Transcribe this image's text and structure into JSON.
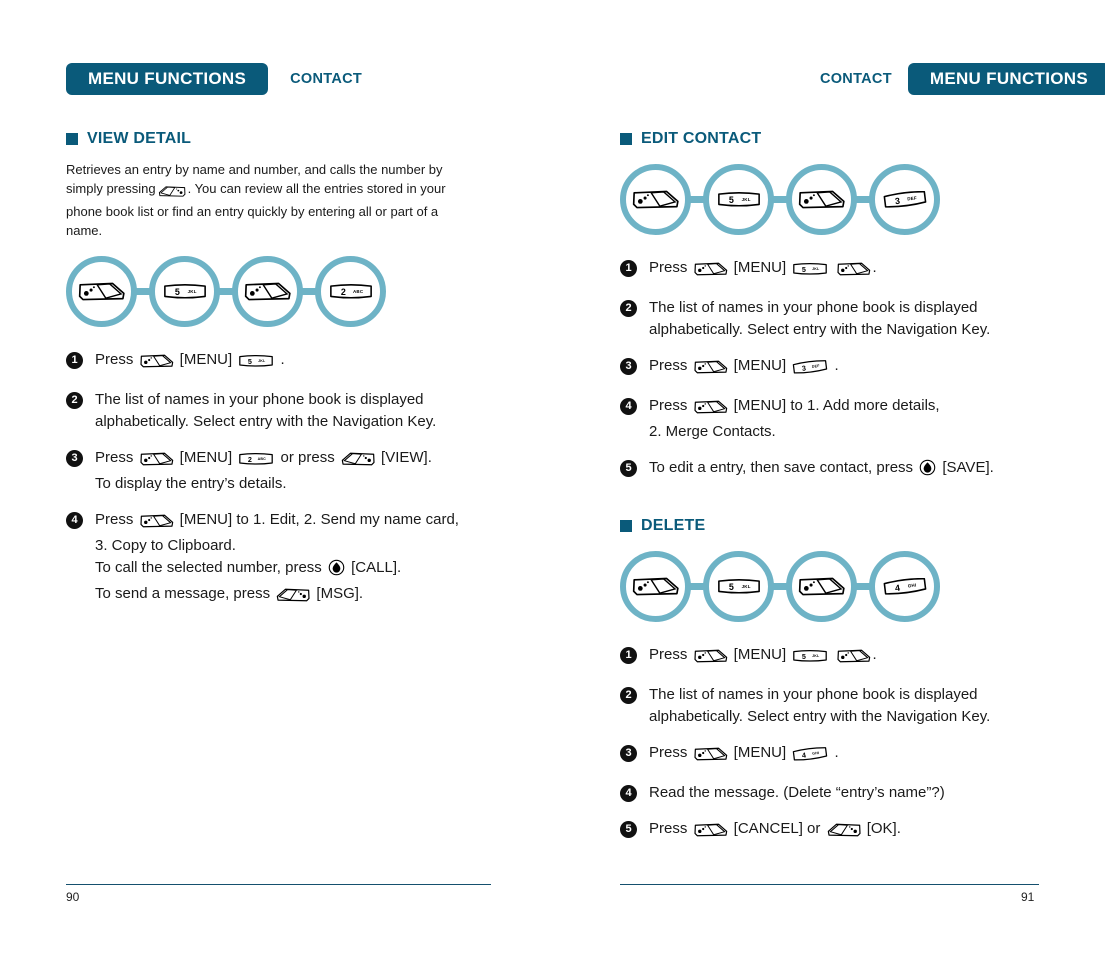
{
  "left_page": {
    "header": {
      "badge": "MENU FUNCTIONS",
      "subtitle": "CONTACT"
    },
    "page_number": "90",
    "sections": [
      {
        "title": "VIEW DETAIL",
        "intro": "Retrieves an entry by name and number, and calls the number by simply pressing  . You can review all the entries stored in your phone book list or find an entry quickly by entering all or part of a name.",
        "intro_line1": "Retrieves an entry by name and number, and calls the number by",
        "intro_line2a": "simply pressing",
        "intro_line2b": ". You can review all the entries stored in your",
        "intro_line3": "phone book list or find an entry quickly by entering all or part of a",
        "intro_line4": "name.",
        "chain": [
          {
            "icon": "menu-key-icon",
            "label": "MENU"
          },
          {
            "icon": "number-key-icon",
            "label": "5 JKL",
            "digit": "5",
            "letters": "JKL"
          },
          {
            "icon": "menu-key-icon",
            "label": "MENU"
          },
          {
            "icon": "number-key-icon",
            "label": "2 ABC",
            "digit": "2",
            "letters": "ABC"
          }
        ],
        "steps": [
          {
            "num": "1",
            "lines": [
              {
                "parts": [
                  {
                    "t": "text",
                    "v": "Press "
                  },
                  {
                    "t": "icon",
                    "v": "menu-key-icon"
                  },
                  {
                    "t": "text",
                    "v": " [MENU] "
                  },
                  {
                    "t": "icon",
                    "v": "key-5-jkl-icon"
                  },
                  {
                    "t": "text",
                    "v": " ."
                  }
                ]
              }
            ]
          },
          {
            "num": "2",
            "lines": [
              {
                "parts": [
                  {
                    "t": "text",
                    "v": "The list of names in your phone book is displayed"
                  }
                ]
              },
              {
                "parts": [
                  {
                    "t": "text",
                    "v": "alphabetically. Select entry with the Navigation Key."
                  }
                ]
              }
            ]
          },
          {
            "num": "3",
            "lines": [
              {
                "parts": [
                  {
                    "t": "text",
                    "v": "Press "
                  },
                  {
                    "t": "icon",
                    "v": "menu-key-icon"
                  },
                  {
                    "t": "text",
                    "v": " [MENU] "
                  },
                  {
                    "t": "icon",
                    "v": "key-2-abc-icon"
                  },
                  {
                    "t": "text",
                    "v": " or press "
                  },
                  {
                    "t": "icon",
                    "v": "send-key-icon"
                  },
                  {
                    "t": "text",
                    "v": " [VIEW]."
                  }
                ]
              },
              {
                "parts": [
                  {
                    "t": "text",
                    "v": "To display the entry’s details."
                  }
                ]
              }
            ]
          },
          {
            "num": "4",
            "lines": [
              {
                "parts": [
                  {
                    "t": "text",
                    "v": "Press "
                  },
                  {
                    "t": "icon",
                    "v": "menu-key-icon"
                  },
                  {
                    "t": "text",
                    "v": " [MENU] to 1. Edit, 2. Send my name card,"
                  }
                ]
              },
              {
                "parts": [
                  {
                    "t": "text",
                    "v": "3. Copy to Clipboard."
                  }
                ]
              },
              {
                "parts": [
                  {
                    "t": "text",
                    "v": "To call the selected number, press "
                  },
                  {
                    "t": "icon",
                    "v": "power-key-icon"
                  },
                  {
                    "t": "text",
                    "v": " [CALL]."
                  }
                ]
              },
              {
                "parts": [
                  {
                    "t": "text",
                    "v": "To send a message, press "
                  },
                  {
                    "t": "icon",
                    "v": "send-key-icon"
                  },
                  {
                    "t": "text",
                    "v": " [MSG]."
                  }
                ]
              }
            ]
          }
        ]
      }
    ]
  },
  "right_page": {
    "header": {
      "badge": "MENU FUNCTIONS",
      "subtitle": "CONTACT"
    },
    "page_number": "91",
    "sections": [
      {
        "title": "EDIT CONTACT",
        "chain": [
          {
            "icon": "menu-key-icon",
            "label": "MENU"
          },
          {
            "icon": "number-key-icon",
            "label": "5 JKL",
            "digit": "5",
            "letters": "JKL"
          },
          {
            "icon": "menu-key-icon",
            "label": "MENU"
          },
          {
            "icon": "number-key-icon",
            "label": "3 DEF",
            "digit": "3",
            "letters": "DEF"
          }
        ],
        "steps": [
          {
            "num": "1",
            "lines": [
              {
                "parts": [
                  {
                    "t": "text",
                    "v": "Press "
                  },
                  {
                    "t": "icon",
                    "v": "menu-key-icon"
                  },
                  {
                    "t": "text",
                    "v": " [MENU] "
                  },
                  {
                    "t": "icon",
                    "v": "key-5-jkl-icon"
                  },
                  {
                    "t": "text",
                    "v": "  "
                  },
                  {
                    "t": "icon",
                    "v": "menu-key-icon"
                  },
                  {
                    "t": "text",
                    "v": "."
                  }
                ]
              }
            ]
          },
          {
            "num": "2",
            "lines": [
              {
                "parts": [
                  {
                    "t": "text",
                    "v": "The list of names in your phone book is displayed"
                  }
                ]
              },
              {
                "parts": [
                  {
                    "t": "text",
                    "v": "alphabetically. Select entry with the Navigation Key."
                  }
                ]
              }
            ]
          },
          {
            "num": "3",
            "lines": [
              {
                "parts": [
                  {
                    "t": "text",
                    "v": "Press "
                  },
                  {
                    "t": "icon",
                    "v": "menu-key-icon"
                  },
                  {
                    "t": "text",
                    "v": " [MENU] "
                  },
                  {
                    "t": "icon",
                    "v": "key-3-def-icon"
                  },
                  {
                    "t": "text",
                    "v": " ."
                  }
                ]
              }
            ]
          },
          {
            "num": "4",
            "lines": [
              {
                "parts": [
                  {
                    "t": "text",
                    "v": "Press "
                  },
                  {
                    "t": "icon",
                    "v": "menu-key-icon"
                  },
                  {
                    "t": "text",
                    "v": " [MENU] to 1. Add more details,"
                  }
                ]
              },
              {
                "parts": [
                  {
                    "t": "text",
                    "v": "2. Merge Contacts."
                  }
                ]
              }
            ]
          },
          {
            "num": "5",
            "lines": [
              {
                "parts": [
                  {
                    "t": "text",
                    "v": "To edit a entry, then save contact, press "
                  },
                  {
                    "t": "icon",
                    "v": "power-key-icon"
                  },
                  {
                    "t": "text",
                    "v": "  [SAVE]."
                  }
                ]
              }
            ]
          }
        ]
      },
      {
        "title": "DELETE",
        "chain": [
          {
            "icon": "menu-key-icon",
            "label": "MENU"
          },
          {
            "icon": "number-key-icon",
            "label": "5 JKL",
            "digit": "5",
            "letters": "JKL"
          },
          {
            "icon": "menu-key-icon",
            "label": "MENU"
          },
          {
            "icon": "number-key-icon",
            "label": "4 GHI",
            "digit": "4",
            "letters": "GHI"
          }
        ],
        "steps": [
          {
            "num": "1",
            "lines": [
              {
                "parts": [
                  {
                    "t": "text",
                    "v": "Press "
                  },
                  {
                    "t": "icon",
                    "v": "menu-key-icon"
                  },
                  {
                    "t": "text",
                    "v": " [MENU] "
                  },
                  {
                    "t": "icon",
                    "v": "key-5-jkl-icon"
                  },
                  {
                    "t": "text",
                    "v": "  "
                  },
                  {
                    "t": "icon",
                    "v": "menu-key-icon"
                  },
                  {
                    "t": "text",
                    "v": "."
                  }
                ]
              }
            ]
          },
          {
            "num": "2",
            "lines": [
              {
                "parts": [
                  {
                    "t": "text",
                    "v": "The list of names in your phone book is displayed"
                  }
                ]
              },
              {
                "parts": [
                  {
                    "t": "text",
                    "v": "alphabetically. Select entry with the Navigation Key."
                  }
                ]
              }
            ]
          },
          {
            "num": "3",
            "lines": [
              {
                "parts": [
                  {
                    "t": "text",
                    "v": "Press "
                  },
                  {
                    "t": "icon",
                    "v": "menu-key-icon"
                  },
                  {
                    "t": "text",
                    "v": " [MENU] "
                  },
                  {
                    "t": "icon",
                    "v": "key-4-ghi-icon"
                  },
                  {
                    "t": "text",
                    "v": " ."
                  }
                ]
              }
            ]
          },
          {
            "num": "4",
            "lines": [
              {
                "parts": [
                  {
                    "t": "text",
                    "v": "Read the message. (Delete “entry’s name”?)"
                  }
                ]
              }
            ]
          },
          {
            "num": "5",
            "lines": [
              {
                "parts": [
                  {
                    "t": "text",
                    "v": "Press "
                  },
                  {
                    "t": "icon",
                    "v": "menu-key-icon"
                  },
                  {
                    "t": "text",
                    "v": " [CANCEL] or "
                  },
                  {
                    "t": "icon",
                    "v": "send-key-icon"
                  },
                  {
                    "t": "text",
                    "v": " [OK]."
                  }
                ]
              }
            ]
          }
        ]
      }
    ]
  },
  "colors": {
    "brand_dark": "#0a5a7a",
    "ring": "#6eb3c6",
    "rule": "#15506e",
    "badge_text": "#ffffff",
    "body_text": "#1a1a1a"
  }
}
